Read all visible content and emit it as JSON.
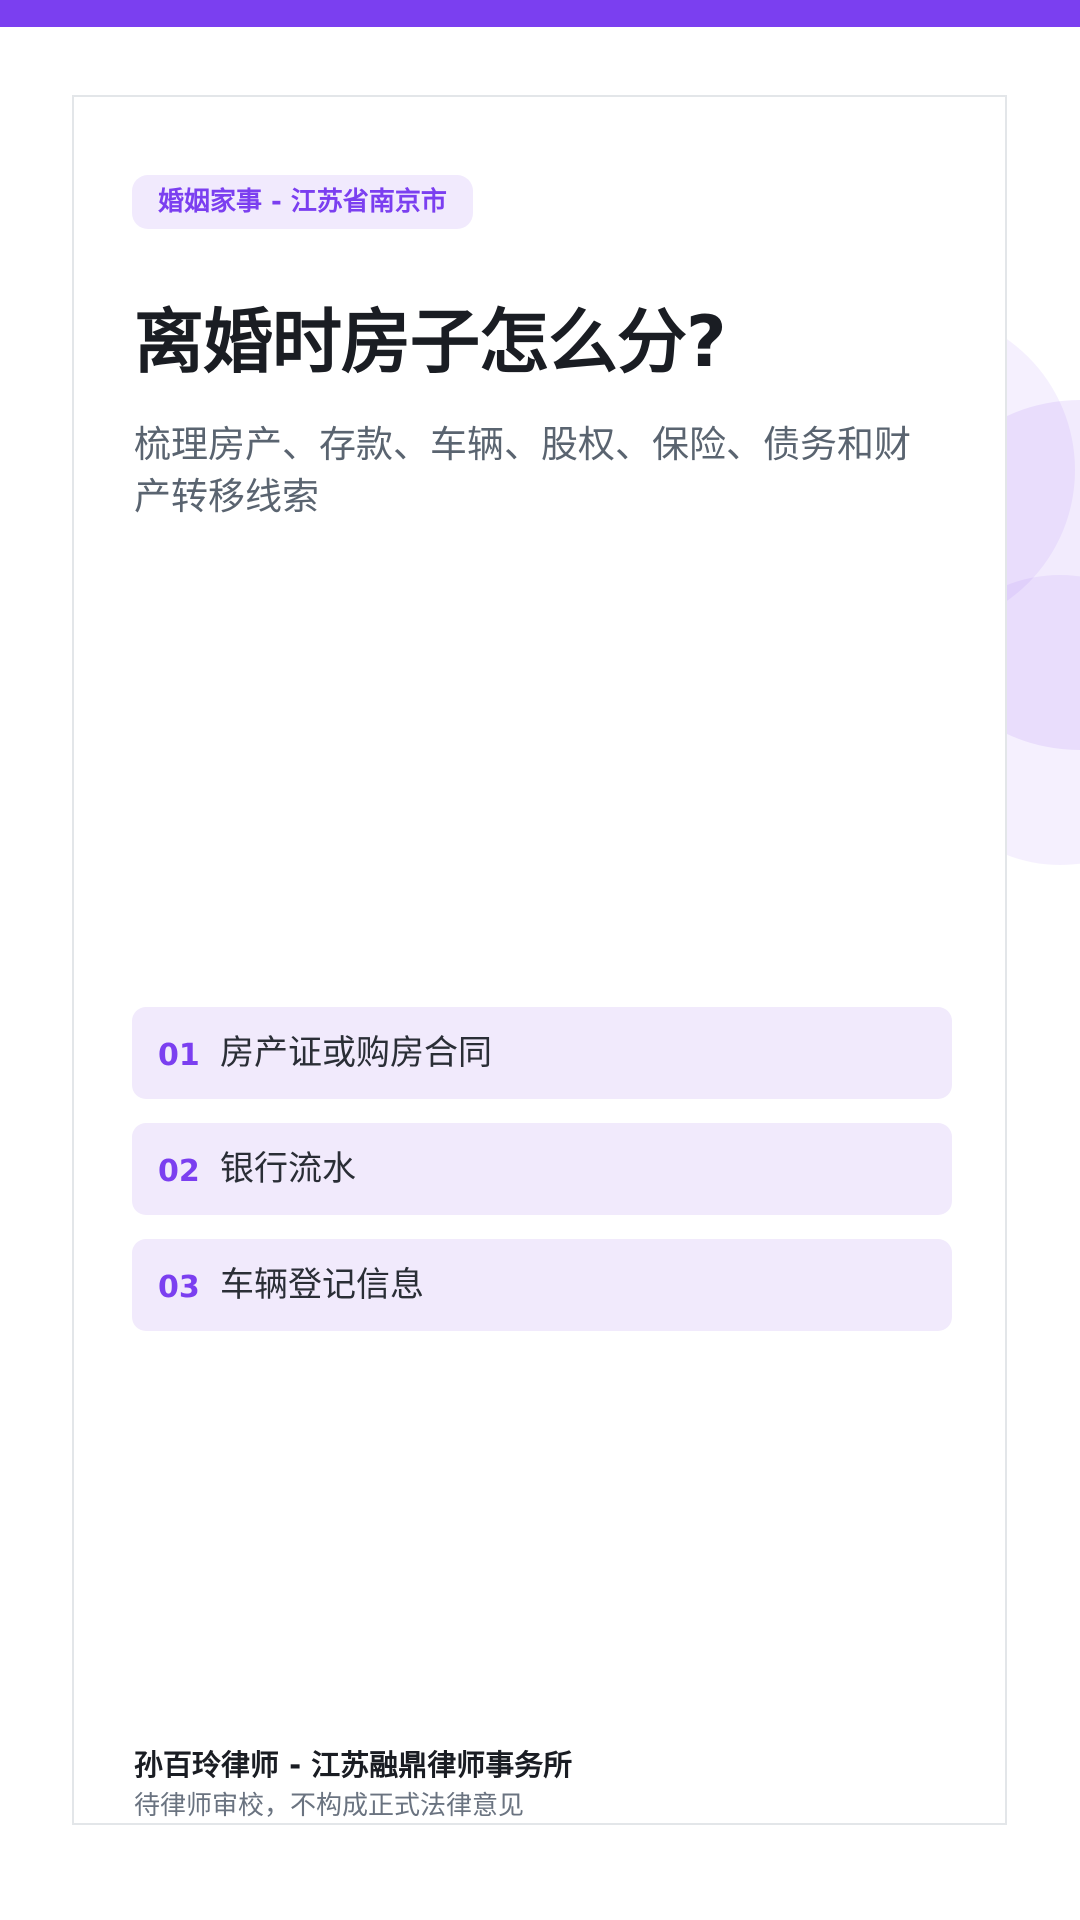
{
  "header": {
    "accent_color": "#7b3ff0"
  },
  "card": {
    "tag": "婚姻家事 - 江苏省南京市",
    "title": "离婚时房子怎么分?",
    "subtitle": "梳理房产、存款、车辆、股权、保险、债务和财产转移线索",
    "checklist": [
      {
        "number": "01",
        "text": "房产证或购房合同"
      },
      {
        "number": "02",
        "text": "银行流水"
      },
      {
        "number": "03",
        "text": "车辆登记信息"
      }
    ]
  },
  "footer": {
    "lawyer": "孙百玲律师 - 江苏融鼎律师事务所",
    "disclaimer": "待律师审校，不构成正式法律意见"
  }
}
